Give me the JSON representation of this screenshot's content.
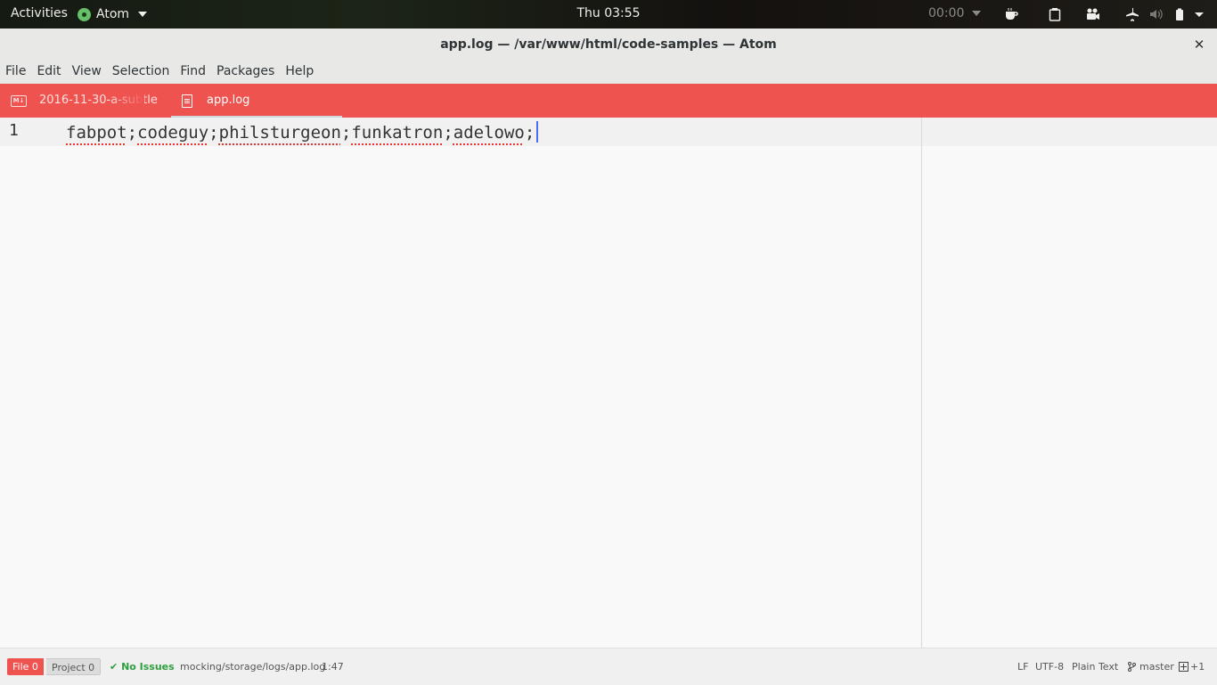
{
  "topbar": {
    "activities": "Activities",
    "app_name": "Atom",
    "clock": "Thu 03:55",
    "timer": "00:00",
    "tray_icons": [
      "coffee-cup-icon",
      "clipboard-icon",
      "video-camera-icon",
      "airplane-mode-icon",
      "volume-muted-icon",
      "battery-icon",
      "system-menu-arrow-icon"
    ]
  },
  "window": {
    "title": "app.log — /var/www/html/code-samples — Atom",
    "close_glyph": "✕"
  },
  "menu": {
    "items": [
      "File",
      "Edit",
      "View",
      "Selection",
      "Find",
      "Packages",
      "Help"
    ]
  },
  "tabs": [
    {
      "label": "2016-11-30-a-subtle",
      "icon": "markdown-icon",
      "active": false
    },
    {
      "label": "app.log",
      "icon": "file-text-icon",
      "active": true
    }
  ],
  "editor": {
    "line_number": "1",
    "tokens": [
      "fabpot",
      "codeguy",
      "philsturgeon",
      "funkatron",
      "adelowo"
    ],
    "separator": ";",
    "cursor_color": "#4a6cf7",
    "lint_underline_color": "#e53935"
  },
  "status": {
    "file_label": "File",
    "file_count": "0",
    "project_label": "Project",
    "project_count": "0",
    "no_issues": "No Issues",
    "path": "mocking/storage/logs/app.log",
    "position": "1:47",
    "line_ending": "LF",
    "encoding": "UTF-8",
    "grammar": "Plain Text",
    "branch": "master",
    "git_changes": "+1"
  },
  "colors": {
    "tab_bar": "#ef5350",
    "editor_bg": "#f9f9f9",
    "no_issues_green": "#2e9f3e"
  }
}
